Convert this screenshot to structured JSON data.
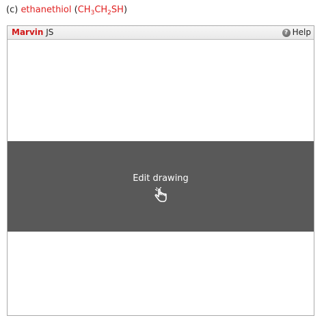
{
  "question": {
    "prefix": "(c)",
    "compound": "ethanethiol",
    "formula_parts": [
      "CH",
      "3",
      "CH",
      "2",
      "SH"
    ]
  },
  "widget": {
    "brand_name": "Marvin",
    "brand_suffix": "JS",
    "help_label": "Help",
    "help_icon": "question-circle-icon",
    "edit_label": "Edit drawing",
    "edit_icon": "hand-pointer-icon"
  },
  "colors": {
    "accent_red": "#e02020",
    "overlay_gray": "#595959"
  }
}
